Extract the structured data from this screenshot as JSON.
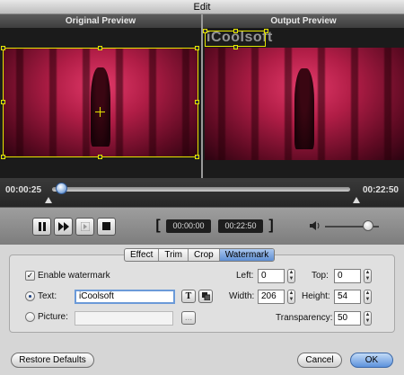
{
  "window": {
    "title": "Edit"
  },
  "preview": {
    "original_label": "Original Preview",
    "output_label": "Output Preview",
    "watermark_overlay_text": "iCoolsoft"
  },
  "timeline": {
    "start_time": "00:00:25",
    "end_time": "00:22:50",
    "position_fraction": 0.02
  },
  "playback": {
    "pause_icon": "pause-icon",
    "fast_forward_icon": "fast-forward-icon",
    "step_icon": "next-frame-icon",
    "stop_icon": "stop-icon",
    "start_field": "00:00:00",
    "end_field": "00:22:50",
    "left_bracket": "[",
    "right_bracket": "]",
    "volume_icon": "volume-icon",
    "volume_fraction": 0.75
  },
  "tabs": [
    {
      "label": "Effect",
      "active": false
    },
    {
      "label": "Trim",
      "active": false
    },
    {
      "label": "Crop",
      "active": false
    },
    {
      "label": "Watermark",
      "active": true
    }
  ],
  "watermark": {
    "enable_label": "Enable watermark",
    "enable_checked": true,
    "text_radio_label": "Text:",
    "text_value": "iCoolsoft",
    "picture_radio_label": "Picture:",
    "picture_value": "",
    "font_button_glyph": "T",
    "browse_button_glyph": "...",
    "left_label": "Left:",
    "left_value": "0",
    "top_label": "Top:",
    "top_value": "0",
    "width_label": "Width:",
    "width_value": "206",
    "height_label": "Height:",
    "height_value": "54",
    "transparency_label": "Transparency:",
    "transparency_value": "50"
  },
  "footer": {
    "restore_label": "Restore Defaults",
    "cancel_label": "Cancel",
    "ok_label": "OK"
  }
}
